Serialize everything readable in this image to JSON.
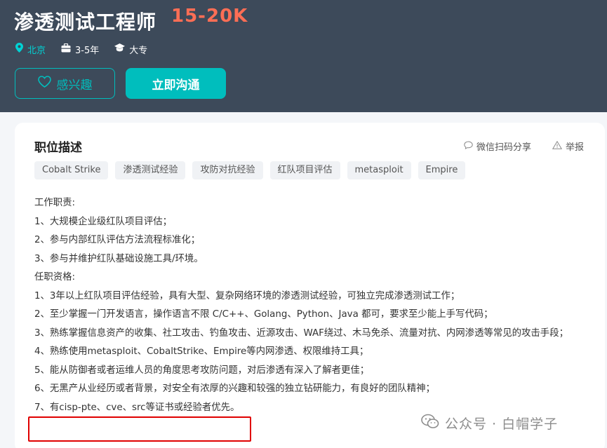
{
  "job": {
    "title": "渗透测试工程师",
    "salary": "15-20K",
    "city": "北京",
    "experience": "3-5年",
    "education": "大专"
  },
  "actions": {
    "interest_label": "感兴趣",
    "chat_label": "立即沟通"
  },
  "card": {
    "section_title": "职位描述",
    "share_label": "微信扫码分享",
    "report_label": "举报",
    "tags": [
      "Cobalt Strike",
      "渗透测试经验",
      "攻防对抗经验",
      "红队项目评估",
      "metasploit",
      "Empire"
    ],
    "description": [
      "工作职责:",
      "1、大规模企业级红队项目评估；",
      "2、参与内部红队评估方法流程标准化；",
      "3、参与并维护红队基础设施工具/环境。",
      "任职资格:",
      "1、3年以上红队项目评估经验，具有大型、复杂网络环境的渗透测试经验，可独立完成渗透测试工作；",
      "2、至少掌握一门开发语言，操作语言不限 C/C++、Golang、Python、Java 都可，要求至少能上手写代码；",
      "3、熟练掌握信息资产的收集、社工攻击、钓鱼攻击、近源攻击、WAF绕过、木马免杀、流量对抗、内网渗透等常见的攻击手段；",
      "4、熟练使用metasploit、CobaltStrike、Empire等内网渗透、权限维持工具；",
      "5、能从防御者或者运维人员的角度思考攻防问题，对后渗透有深入了解者更佳；",
      "6、无黑产从业经历或者背景，对安全有浓厚的兴趣和较强的独立钻研能力，有良好的团队精神；",
      "7、有cisp-pte、cve、src等证书或经验者优先。"
    ]
  },
  "watermark": {
    "text": "公众号 · 白帽学子"
  },
  "colors": {
    "header_bg": "#3d4a5a",
    "accent": "#00bebd",
    "salary": "#fe6e55",
    "highlight": "#e00000"
  }
}
